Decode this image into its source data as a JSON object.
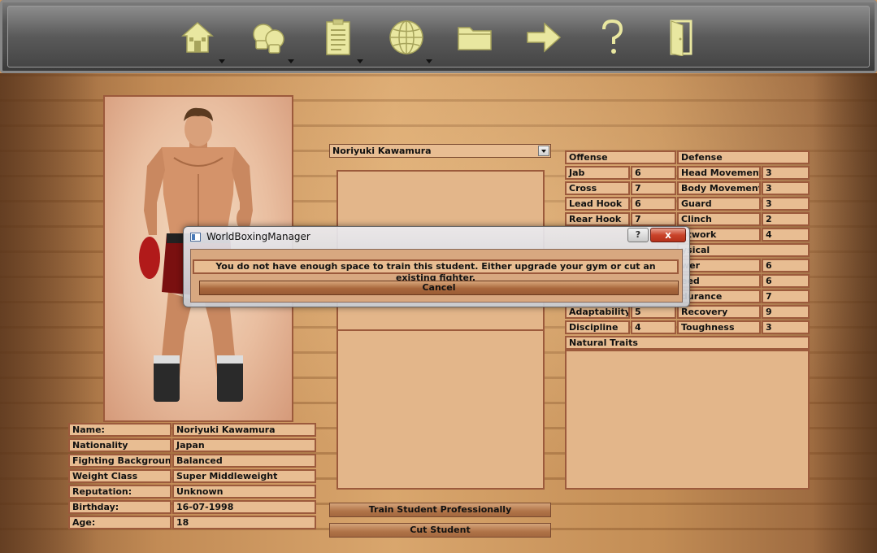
{
  "toolbar": {
    "buttons": [
      {
        "icon": "home-icon",
        "has_menu": true
      },
      {
        "icon": "boxing-gloves-icon",
        "has_menu": true
      },
      {
        "icon": "clipboard-icon",
        "has_menu": true
      },
      {
        "icon": "globe-icon",
        "has_menu": true
      },
      {
        "icon": "folder-icon",
        "has_menu": false
      },
      {
        "icon": "arrow-right-icon",
        "has_menu": false
      },
      {
        "icon": "help-icon",
        "has_menu": false
      },
      {
        "icon": "exit-door-icon",
        "has_menu": false
      }
    ],
    "icon_color": "#e9e7a0"
  },
  "student_select": {
    "value": "Noriyuki Kawamura"
  },
  "info": {
    "rows": [
      {
        "label": "Name:",
        "value": "Noriyuki Kawamura"
      },
      {
        "label": "Nationality",
        "value": "Japan"
      },
      {
        "label": "Fighting Background:",
        "value": "Balanced"
      },
      {
        "label": "Weight Class",
        "value": "Super Middleweight"
      },
      {
        "label": "Reputation:",
        "value": "Unknown"
      },
      {
        "label": "Birthday:",
        "value": "16-07-1998"
      },
      {
        "label": "Age:",
        "value": "18"
      }
    ]
  },
  "stats": {
    "offense_header": "Offense",
    "defense_header": "Defense",
    "offense": [
      {
        "label": "Jab",
        "value": "6"
      },
      {
        "label": "Cross",
        "value": "7"
      },
      {
        "label": "Lead Hook",
        "value": "6"
      },
      {
        "label": "Rear Hook",
        "value": "7"
      }
    ],
    "defense": [
      {
        "label": "Head Movement",
        "value": "3"
      },
      {
        "label": "Body Movement",
        "value": "3"
      },
      {
        "label": "Guard",
        "value": "3"
      },
      {
        "label": "Clinch",
        "value": "2"
      },
      {
        "label": "otwork",
        "value": "4"
      }
    ],
    "physical_header": "ysical",
    "physical": [
      {
        "label": "wer",
        "value": "6"
      },
      {
        "label": "eed",
        "value": "6"
      },
      {
        "label": "durance",
        "value": "7"
      },
      {
        "label": "Recovery",
        "value": "9"
      },
      {
        "label": "Toughness",
        "value": "3"
      }
    ],
    "mental": [
      {
        "label": "Adaptability",
        "value": "5"
      },
      {
        "label": "Discipline",
        "value": "4"
      }
    ],
    "natural_traits_header": "Natural Traits"
  },
  "buttons": {
    "train": "Train Student Professionally",
    "cut": "Cut Student"
  },
  "dialog": {
    "title": "WorldBoxingManager",
    "help": "?",
    "close": "x",
    "message": "You do not have enough space to train this student. Either upgrade your gym or cut an existing fighter.",
    "cancel": "Cancel"
  }
}
